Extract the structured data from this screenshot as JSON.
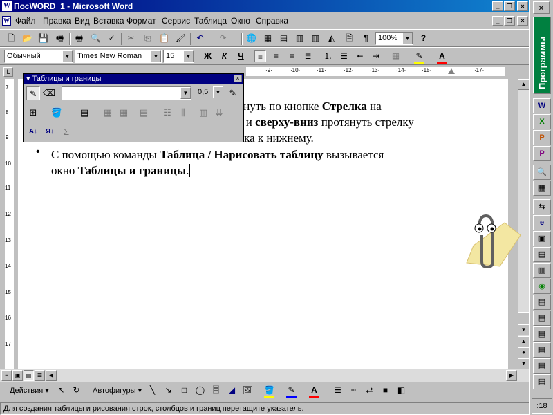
{
  "window": {
    "title": "ПосWORD_1 - Microsoft Word",
    "icon_letter": "W",
    "minimize": "_",
    "restore": "❐",
    "close": "×"
  },
  "menu": [
    "Файл",
    "Правка",
    "Вид",
    "Вставка",
    "Формат",
    "Сервис",
    "Таблица",
    "Окно",
    "Справка"
  ],
  "toolbar_std": {
    "zoom": "100%"
  },
  "toolbar_fmt": {
    "style": "Обычный",
    "font": "Times New Roman",
    "size": "15",
    "bold": "Ж",
    "italic": "К",
    "underline": "Ч",
    "color_letter": "A"
  },
  "ruler": {
    "h_marks": [
      "·9·",
      "·10·",
      "·11·",
      "·12·",
      "·13·",
      "·14·",
      "·15·",
      "·17·"
    ],
    "v_marks": [
      "7",
      "8",
      "9",
      "10",
      "11",
      "12",
      "13",
      "14",
      "15",
      "16",
      "17"
    ]
  },
  "tables_panel": {
    "title": "Таблицы и границы",
    "line_width": "0,5",
    "sort_asc": "А↓",
    "sort_desc": "Я↓",
    "sum": "Σ"
  },
  "document": {
    "line1_a": "кнуть по кнопке ",
    "line1_b": "Стрелка",
    "line1_c": " на",
    "line2_a": "е и ",
    "line2_b": "сверху-вниз",
    "line2_c": " протянуть стрелку",
    "line3_a": "ика к нижнему.",
    "bullet": "•",
    "line4_a": "С помощью команды ",
    "line4_b": "Таблица / Нарисовать таблицу",
    "line4_c": " вызывается",
    "line5_a": "окно ",
    "line5_b": "Таблицы и границы",
    "line5_c": "."
  },
  "drawing_bar": {
    "actions": "Действия ▾",
    "autoshapes": "Автофигуры ▾",
    "color_letter": "A"
  },
  "status": "Для создания таблицы и рисования строк, столбцов и границ перетащите указатель.",
  "office_bar": {
    "programs": "Программы",
    "clock": ":18"
  },
  "colors": {
    "title_blue": "#000080",
    "programs_green": "#008040",
    "highlight_yellow": "#ffff00",
    "font_red": "#ff0000"
  }
}
